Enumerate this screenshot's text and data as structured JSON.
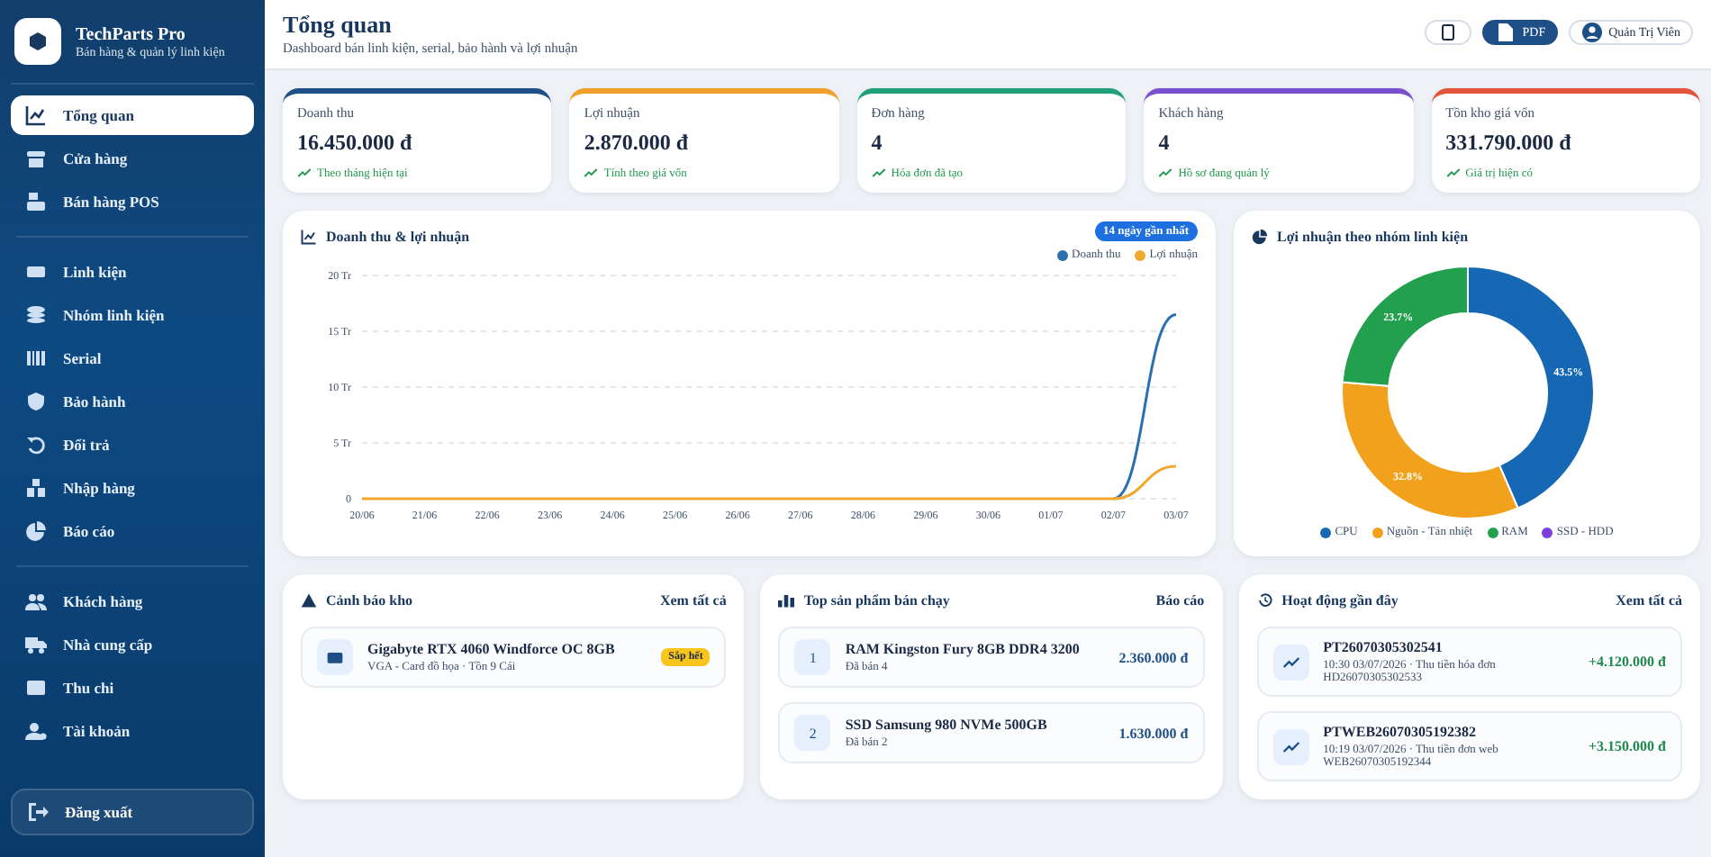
{
  "brand": {
    "name": "TechParts Pro",
    "tagline": "Bán hàng & quản lý linh kiện"
  },
  "nav": [
    {
      "label": "Tổng quan",
      "selected": true,
      "divider_above": false
    },
    {
      "label": "Cửa hàng",
      "selected": false,
      "divider_above": false
    },
    {
      "label": "Bán hàng POS",
      "selected": false,
      "divider_above": false
    },
    {
      "label": "Linh kiện",
      "selected": false,
      "divider_above": true
    },
    {
      "label": "Nhóm linh kiện",
      "selected": false,
      "divider_above": false
    },
    {
      "label": "Serial",
      "selected": false,
      "divider_above": false
    },
    {
      "label": "Bảo hành",
      "selected": false,
      "divider_above": false
    },
    {
      "label": "Đổi trả",
      "selected": false,
      "divider_above": false
    },
    {
      "label": "Nhập hàng",
      "selected": false,
      "divider_above": false
    },
    {
      "label": "Báo cáo",
      "selected": false,
      "divider_above": false
    },
    {
      "label": "Khách hàng",
      "selected": false,
      "divider_above": true
    },
    {
      "label": "Nhà cung cấp",
      "selected": false,
      "divider_above": false
    },
    {
      "label": "Thu chi",
      "selected": false,
      "divider_above": false
    },
    {
      "label": "Tài khoản",
      "selected": false,
      "divider_above": false
    }
  ],
  "logout": "Đăng xuất",
  "header": {
    "title": "Tổng quan",
    "subtitle": "Dashboard bán linh kiện, serial, bảo hành và lợi nhuận",
    "pdf": "PDF",
    "user": "Quản Trị Viên"
  },
  "stats": [
    {
      "label": "Doanh thu",
      "value": "16.450.000 đ",
      "note": "Theo tháng hiện tại",
      "color": "#1e4f86"
    },
    {
      "label": "Lợi nhuận",
      "value": "2.870.000 đ",
      "note": "Tính theo giá vốn",
      "color": "#f0a02a"
    },
    {
      "label": "Đơn hàng",
      "value": "4",
      "note": "Hóa đơn đã tạo",
      "color": "#22a07a"
    },
    {
      "label": "Khách hàng",
      "value": "4",
      "note": "Hồ sơ đang quản lý",
      "color": "#7a4fd0"
    },
    {
      "label": "Tồn kho giá vốn",
      "value": "331.790.000 đ",
      "note": "Giá trị hiện có",
      "color": "#e2553a"
    }
  ],
  "revenue_chart": {
    "title": "Doanh thu & lợi nhuận",
    "badge": "14 ngày gần nhất",
    "chart_data": {
      "type": "line",
      "categories": [
        "20/06",
        "21/06",
        "22/06",
        "23/06",
        "24/06",
        "25/06",
        "26/06",
        "27/06",
        "28/06",
        "29/06",
        "30/06",
        "01/07",
        "02/07",
        "03/07"
      ],
      "series": [
        {
          "name": "Doanh thu",
          "color": "#2a6fb0",
          "values": [
            null,
            null,
            null,
            null,
            null,
            null,
            null,
            null,
            null,
            null,
            null,
            null,
            0,
            16.5
          ]
        },
        {
          "name": "Lợi nhuận",
          "color": "#f0a830",
          "values": [
            0,
            0,
            0,
            0,
            0,
            0,
            0,
            0,
            0,
            0,
            0,
            0,
            0,
            2.9
          ]
        }
      ],
      "grid": true,
      "ylim": [
        0,
        20
      ],
      "yticks": [
        {
          "value": 0,
          "label": "0"
        },
        {
          "value": 5,
          "label": "5 Tr"
        },
        {
          "value": 10,
          "label": "10 Tr"
        },
        {
          "value": 15,
          "label": "15 Tr"
        },
        {
          "value": 20,
          "label": "20 Tr"
        }
      ]
    }
  },
  "profit_chart": {
    "title": "Lợi nhuận theo nhóm linh kiện",
    "chart_data": {
      "type": "donut",
      "categories": [
        "CPU",
        "Nguồn - Tản nhiệt",
        "RAM",
        "SSD - HDD"
      ],
      "values": [
        43.5,
        32.8,
        23.7,
        0
      ],
      "colors": [
        "#1768b4",
        "#f1a11b",
        "#23a04e",
        "#7b3fe0"
      ],
      "value_labels": [
        "43.5%",
        "32.8%",
        "23.7%",
        null
      ]
    }
  },
  "stock_alert": {
    "title": "Cảnh báo kho",
    "link": "Xem tất cả",
    "items": [
      {
        "name": "Gigabyte RTX 4060 Windforce OC 8GB",
        "detail": "VGA - Card đồ họa · Tồn 9 Cái",
        "badge": "Sắp hết"
      }
    ]
  },
  "top_products": {
    "title": "Top sản phẩm bán chạy",
    "link": "Báo cáo",
    "items": [
      {
        "rank": "1",
        "name": "RAM Kingston Fury 8GB DDR4 3200",
        "detail": "Đã bán 4",
        "amount": "2.360.000 đ"
      },
      {
        "rank": "2",
        "name": "SSD Samsung 980 NVMe 500GB",
        "detail": "Đã bán 2",
        "amount": "1.630.000 đ"
      }
    ]
  },
  "activity": {
    "title": "Hoạt động gần đây",
    "link": "Xem tất cả",
    "items": [
      {
        "code": "PT26070305302541",
        "detail": "10:30 03/07/2026 · Thu tiền hóa đơn HD26070305302533",
        "amount": "+4.120.000 đ"
      },
      {
        "code": "PTWEB26070305192382",
        "detail": "10:19 03/07/2026 · Thu tiền đơn web WEB26070305192344",
        "amount": "+3.150.000 đ"
      }
    ]
  }
}
